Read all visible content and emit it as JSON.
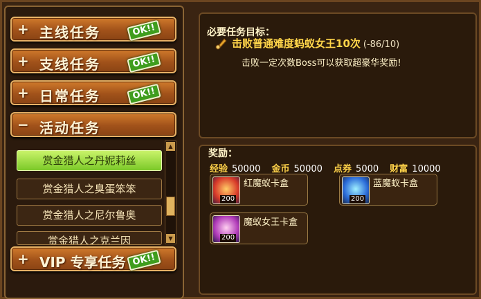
{
  "categories": [
    {
      "sign": "+",
      "label": "主线任务",
      "ok": "OK!!"
    },
    {
      "sign": "+",
      "label": "支线任务",
      "ok": "OK!!"
    },
    {
      "sign": "+",
      "label": "日常任务",
      "ok": "OK!!"
    },
    {
      "sign": "−",
      "label": "活动任务"
    },
    {
      "sign": "+",
      "label": "VIP 专享任务",
      "ok": "OK!!"
    }
  ],
  "subtasks": [
    "赏金猎人之丹妮莉丝",
    "赏金猎人之臭蛋笨笨",
    "赏金猎人之尼尔鲁奥",
    "赏金猎人之克兰因"
  ],
  "objective": {
    "heading": "必要任务目标：",
    "goal": "击败普通难度蚂蚁女王10次",
    "count": "(-86/10)",
    "desc": "击败一定次数Boss可以获取超豪华奖励!"
  },
  "rewards": {
    "heading": "奖励：",
    "stats": [
      {
        "k": "经验",
        "v": "50000"
      },
      {
        "k": "金币",
        "v": "50000"
      },
      {
        "k": "点券",
        "v": "5000"
      },
      {
        "k": "财富",
        "v": "10000"
      }
    ],
    "items": [
      {
        "name": "红魔蚁卡盒",
        "qty": "200",
        "color": "#d83a2a"
      },
      {
        "name": "蓝魔蚁卡盒",
        "qty": "200",
        "color": "#2a6ad8"
      },
      {
        "name": "魔蚁女王卡盒",
        "qty": "200",
        "color": "#b03ab8"
      }
    ]
  }
}
